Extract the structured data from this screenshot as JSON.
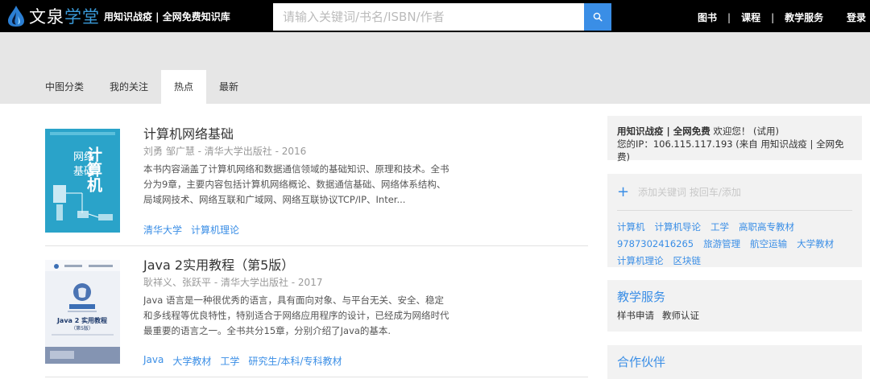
{
  "header": {
    "logo_text_a": "文泉",
    "logo_text_b": "学堂",
    "slogan": "用知识战疫 | 全网免费知识库",
    "search_placeholder": "请输入关键词/书名/ISBN/作者",
    "nav": [
      "图书",
      "课程",
      "教学服务"
    ],
    "nav_separator": "|",
    "login": "登录",
    "colors": {
      "bar": "#000000",
      "accent": "#3a8ee6"
    }
  },
  "tabs": [
    {
      "label": "中图分类",
      "active": false
    },
    {
      "label": "我的关注",
      "active": false
    },
    {
      "label": "热点",
      "active": true
    },
    {
      "label": "最新",
      "active": false
    }
  ],
  "books": [
    {
      "title": "计算机网络基础",
      "meta": "刘勇 邹广慧 - 清华大学出版社 - 2016",
      "desc": "本书内容涵盖了计算机网络和数据通信领域的基础知识、原理和技术。全书分为9章，主要内容包括计算机网络概论、数据通信基础、网络体系结构、局域网技术、网络互联和广域网、网络互联协议TCP/IP、Inter...",
      "tags": [
        "清华大学",
        "计算机理论"
      ],
      "cover": {
        "line1": "网络",
        "line2": "基础",
        "big": "计算机"
      }
    },
    {
      "title": "Java 2实用教程（第5版）",
      "meta": "耿祥义、张跃平 - 清华大学出版社 - 2017",
      "desc": "Java 语言是一种很优秀的语言，具有面向对象、与平台无关、安全、稳定和多线程等优良特性，特别适合于网络应用程序的设计，已经成为网络时代最重要的语言之一。全书共分15章，分别介绍了Java的基本.",
      "tags": [
        "Java",
        "大学教材",
        "工学",
        "研究生/本科/专科教材"
      ],
      "cover": {
        "title": "Java 2 实用教程",
        "edition": "（第5版）"
      }
    }
  ],
  "sidebar": {
    "user": {
      "brand": "用知识战疫 | 全网免费",
      "welcome": " 欢迎您！ (试用)",
      "ip_label": "您的IP：106.115.117.193 (来自 用知识战疫 | 全网免费)"
    },
    "tag_panel": {
      "add_placeholder": "添加关键词 按回车/添加",
      "tags": [
        "计算机",
        "计算机导论",
        "工学",
        "高职高专教材",
        "9787302416265",
        "旅游管理",
        "航空运输",
        "大学教材",
        "计算机理论",
        "区块链"
      ]
    },
    "service": {
      "title": "教学服务",
      "links": [
        "样书申请",
        "教师认证"
      ]
    },
    "partner": {
      "title": "合作伙伴"
    }
  }
}
